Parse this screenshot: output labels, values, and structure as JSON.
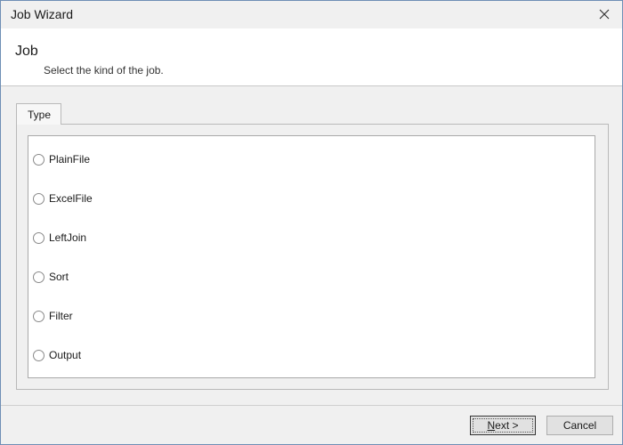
{
  "window": {
    "title": "Job Wizard",
    "close_label": "✕"
  },
  "header": {
    "title": "Job",
    "subtitle": "Select the kind of the job."
  },
  "tabs": [
    {
      "label": "Type",
      "selected": true
    }
  ],
  "job_types": [
    {
      "label": "PlainFile",
      "checked": false
    },
    {
      "label": "ExcelFile",
      "checked": false
    },
    {
      "label": "LeftJoin",
      "checked": false
    },
    {
      "label": "Sort",
      "checked": false
    },
    {
      "label": "Filter",
      "checked": false
    },
    {
      "label": "Output",
      "checked": false
    }
  ],
  "footer": {
    "next_label": "Next >",
    "cancel_label": "Cancel"
  },
  "colors": {
    "window_border": "#6f8fb5",
    "background": "#f0f0f0",
    "panel": "#ffffff"
  }
}
